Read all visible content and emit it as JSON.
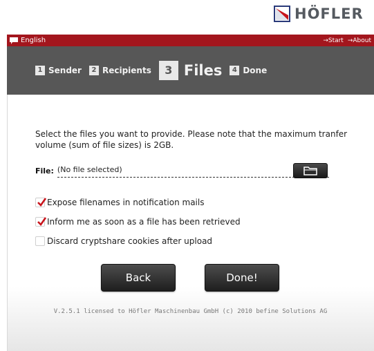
{
  "brand": {
    "name": "HÖFLER",
    "color": "#555a60",
    "accent": "#a3161d"
  },
  "topbar": {
    "language": "English",
    "links": [
      "→Start",
      "→About"
    ]
  },
  "steps": [
    {
      "number": "1",
      "label": "Sender",
      "active": false
    },
    {
      "number": "2",
      "label": "Recipients",
      "active": false
    },
    {
      "number": "3",
      "label": "Files",
      "active": true
    },
    {
      "number": "4",
      "label": "Done",
      "active": false
    }
  ],
  "main": {
    "intro": "Select the files you want to provide. Please note that the maximum tranfer volume (sum of file sizes) is 2GB.",
    "file_label": "File:",
    "file_value": "(No file selected)",
    "options": [
      {
        "label": "Expose filenames in notification mails",
        "checked": true
      },
      {
        "label": "Inform me as soon as a file has been retrieved",
        "checked": true
      },
      {
        "label": "Discard cryptshare cookies after upload",
        "checked": false
      }
    ],
    "back_label": "Back",
    "done_label": "Done!"
  },
  "footer": "V.2.5.1 licensed to Höfler Maschinenbau GmbH (c) 2010 befine Solutions AG"
}
